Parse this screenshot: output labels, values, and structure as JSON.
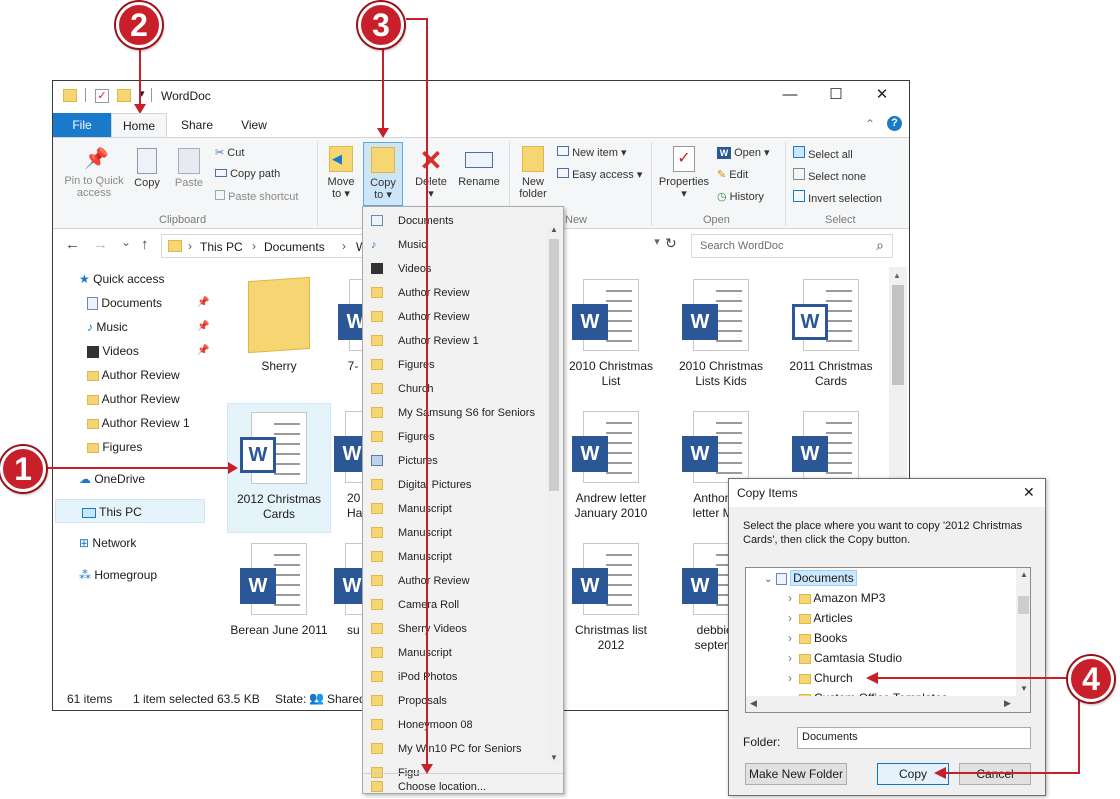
{
  "window": {
    "title": "WordDoc",
    "minimize": "—",
    "maximize": "☐",
    "close": "✕"
  },
  "tabs": {
    "file": "File",
    "home": "Home",
    "share": "Share",
    "view": "View",
    "help": "?",
    "collapse": "⌃"
  },
  "ribbon": {
    "pin_line1": "Pin to Quick",
    "pin_line2": "access",
    "copy": "Copy",
    "paste": "Paste",
    "cut": "Cut",
    "copy_path": "Copy path",
    "paste_shortcut": "Paste shortcut",
    "move_to": "Move",
    "move_to2": "to",
    "copy_to": "Copy",
    "copy_to2": "to",
    "delete": "Delete",
    "rename": "Rename",
    "new_folder": "New",
    "new_folder2": "folder",
    "new_item": "New item",
    "easy_access": "Easy access",
    "properties": "Properties",
    "open": "Open",
    "edit": "Edit",
    "history": "History",
    "select_all": "Select all",
    "select_none": "Select none",
    "invert_selection": "Invert selection",
    "grp_clipboard": "Clipboard",
    "grp_new": "New",
    "grp_open": "Open",
    "grp_select": "Select",
    "dd": "▾"
  },
  "address": {
    "this_pc": "This PC",
    "documents": "Documents",
    "wo": "Wo",
    "search_placeholder": "Search WordDoc",
    "refresh": "↻",
    "back": "←",
    "fwd": "→",
    "up": "↑",
    "recent": "⌄",
    "search_icon": "⌕"
  },
  "nav": {
    "quick_access": "Quick access",
    "documents": "Documents",
    "music": "Music",
    "videos": "Videos",
    "author_review": "Author Review",
    "author_review_b": "Author Review",
    "author_review_1": "Author Review 1",
    "figures": "Figures",
    "onedrive": "OneDrive",
    "this_pc": "This PC",
    "network": "Network",
    "homegroup": "Homegroup"
  },
  "files": {
    "sherry": "Sherry",
    "f7": "7-",
    "c2010_1": "2010 Christmas",
    "c2010_2": "List",
    "k2010_1": "2010 Christmas",
    "k2010_2": "Lists Kids",
    "c2011_1": "2011 Christmas",
    "c2011_2": "Cards",
    "c2012_1": "2012 Christmas",
    "c2012_2": "Cards",
    "f20_1": "20",
    "f20_2": "Ha",
    "andrew_1": "Andrew letter",
    "andrew_2": "January 2010",
    "anthony_1": "Anthony S",
    "anthony_2": "letter Marc",
    "berean": "Berean June 2011",
    "su": "su",
    "xmas_1": "Christmas list",
    "xmas_2": "2012",
    "debbie_1": "debbie al",
    "debbie_2": "septembe",
    "w": "W"
  },
  "status": {
    "items": "61 items",
    "selected": "1 item selected",
    "size": "63.5 KB",
    "state": "State:",
    "shared": "Shared"
  },
  "menu": {
    "items": [
      "Documents",
      "Music",
      "Videos",
      "Author Review",
      "Author Review",
      "Author Review 1",
      "Figures",
      "Church",
      "My Samsung S6 for Seniors",
      "Figures",
      "Pictures",
      "Digital Pictures",
      "Manuscript",
      "Manuscript",
      "Manuscript",
      "Author Review",
      "Camera Roll",
      "Sherry Videos",
      "Manuscript",
      "iPod Photos",
      "Proposals",
      "Honeymoon 08",
      "My Win10 PC for Seniors",
      "Figu"
    ],
    "choose_location": "Choose location..."
  },
  "dialog": {
    "title": "Copy Items",
    "close": "✕",
    "instructions_1": "Select the place where you want to copy '2012 Christmas",
    "instructions_2": "Cards', then click the Copy button.",
    "tree": {
      "documents": "Documents",
      "amazon": "Amazon MP3",
      "articles": "Articles",
      "books": "Books",
      "camtasia": "Camtasia Studio",
      "church": "Church",
      "custom": "Custom Office Templates"
    },
    "folder_label": "Folder:",
    "folder_value": "Documents",
    "make_new_folder": "Make New Folder",
    "copy": "Copy",
    "cancel": "Cancel"
  },
  "callouts": {
    "c1": "1",
    "c2": "2",
    "c3": "3",
    "c4": "4"
  },
  "colors": {
    "accent": "#1979ca",
    "callout": "#c8202a",
    "word": "#2b5797"
  }
}
